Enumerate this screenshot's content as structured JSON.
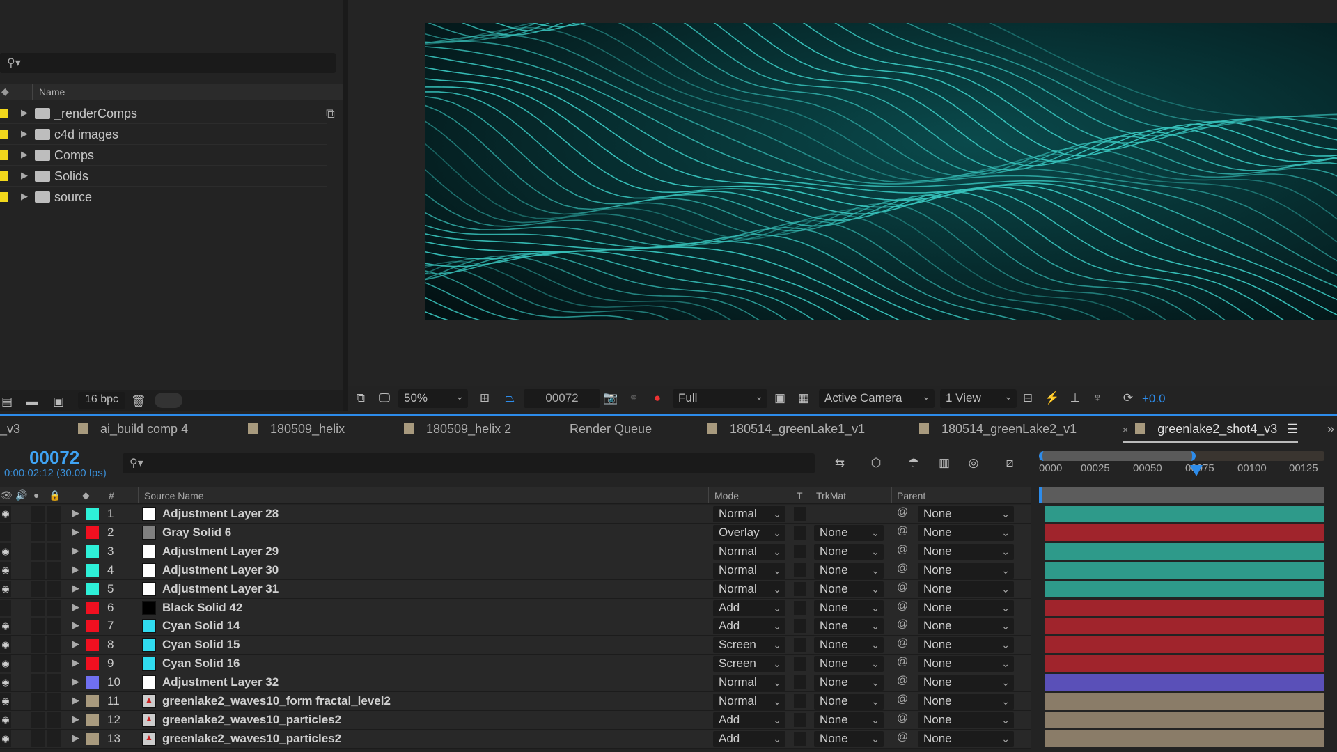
{
  "project": {
    "search_placeholder": "",
    "column_name": "Name",
    "folders": [
      {
        "name": "_renderComps"
      },
      {
        "name": "c4d images"
      },
      {
        "name": "Comps"
      },
      {
        "name": "Solids"
      },
      {
        "name": "source"
      }
    ],
    "bit_depth": "16 bpc",
    "label_color": "#f2d81c"
  },
  "viewer": {
    "zoom": "50%",
    "frame": "00072",
    "resolution": "Full",
    "camera": "Active Camera",
    "views": "1 View",
    "exposure": "+0.0"
  },
  "tabs": [
    {
      "label": "_v3",
      "swatch": false
    },
    {
      "label": "ai_build comp 4",
      "swatch": true
    },
    {
      "label": "180509_helix",
      "swatch": true
    },
    {
      "label": "180509_helix 2",
      "swatch": true
    },
    {
      "label": "Render Queue",
      "swatch": false
    },
    {
      "label": "180514_greenLake1_v1",
      "swatch": true
    },
    {
      "label": "180514_greenLake2_v1",
      "swatch": true
    },
    {
      "label": "greenlake2_shot4_v3",
      "swatch": true,
      "active": true
    }
  ],
  "timeline": {
    "timecode": "00072",
    "timecode_sub": "0:00:02:12 (30.00 fps)",
    "columns": {
      "num": "#",
      "source_name": "Source Name",
      "mode": "Mode",
      "t": "T",
      "trkmat": "TrkMat",
      "parent": "Parent"
    },
    "ruler_ticks": [
      "0000",
      "00025",
      "00050",
      "00075",
      "00100",
      "00125"
    ],
    "current_frame": 72,
    "layers": [
      {
        "num": "1",
        "name": "Adjustment Layer 28",
        "label": "#2ef0d8",
        "src": "#ffffff",
        "mode": "Normal",
        "trkmat": "",
        "parent": "None",
        "visible": true,
        "bar": "#2e9a8a"
      },
      {
        "num": "2",
        "name": "Gray Solid 6",
        "label": "#f01020",
        "src": "#808080",
        "mode": "Overlay",
        "trkmat": "None",
        "parent": "None",
        "visible": false,
        "bar": "#a0242c"
      },
      {
        "num": "3",
        "name": "Adjustment Layer 29",
        "label": "#2ef0d8",
        "src": "#ffffff",
        "mode": "Normal",
        "trkmat": "None",
        "parent": "None",
        "visible": true,
        "bar": "#2e9a8a"
      },
      {
        "num": "4",
        "name": "Adjustment Layer 30",
        "label": "#2ef0d8",
        "src": "#ffffff",
        "mode": "Normal",
        "trkmat": "None",
        "parent": "None",
        "visible": true,
        "bar": "#2e9a8a"
      },
      {
        "num": "5",
        "name": "Adjustment Layer 31",
        "label": "#2ef0d8",
        "src": "#ffffff",
        "mode": "Normal",
        "trkmat": "None",
        "parent": "None",
        "visible": true,
        "bar": "#2e9a8a"
      },
      {
        "num": "6",
        "name": "Black Solid 42",
        "label": "#f01020",
        "src": "#000000",
        "mode": "Add",
        "trkmat": "None",
        "parent": "None",
        "visible": false,
        "bar": "#a0242c"
      },
      {
        "num": "7",
        "name": "Cyan Solid 14",
        "label": "#f01020",
        "src": "#30dcf0",
        "mode": "Add",
        "trkmat": "None",
        "parent": "None",
        "visible": true,
        "bar": "#a0242c"
      },
      {
        "num": "8",
        "name": "Cyan Solid 15",
        "label": "#f01020",
        "src": "#30dcf0",
        "mode": "Screen",
        "trkmat": "None",
        "parent": "None",
        "visible": true,
        "bar": "#a0242c"
      },
      {
        "num": "9",
        "name": "Cyan Solid 16",
        "label": "#f01020",
        "src": "#30dcf0",
        "mode": "Screen",
        "trkmat": "None",
        "parent": "None",
        "visible": true,
        "bar": "#a0242c"
      },
      {
        "num": "10",
        "name": "Adjustment Layer 32",
        "label": "#7070f0",
        "src": "#ffffff",
        "mode": "Normal",
        "trkmat": "None",
        "parent": "None",
        "visible": true,
        "bar": "#5a50b8"
      },
      {
        "num": "11",
        "name": "greenlake2_waves10_form fractal_level2",
        "label": "#a89a7e",
        "src": "comp",
        "mode": "Normal",
        "trkmat": "None",
        "parent": "None",
        "visible": true,
        "bar": "#8a7c68"
      },
      {
        "num": "12",
        "name": "greenlake2_waves10_particles2",
        "label": "#a89a7e",
        "src": "comp",
        "mode": "Add",
        "trkmat": "None",
        "parent": "None",
        "visible": true,
        "bar": "#8a7c68"
      },
      {
        "num": "13",
        "name": "greenlake2_waves10_particles2",
        "label": "#a89a7e",
        "src": "comp",
        "mode": "Add",
        "trkmat": "None",
        "parent": "None",
        "visible": true,
        "bar": "#8a7c68"
      }
    ]
  },
  "colors": {
    "accent": "#2d8ceb"
  }
}
